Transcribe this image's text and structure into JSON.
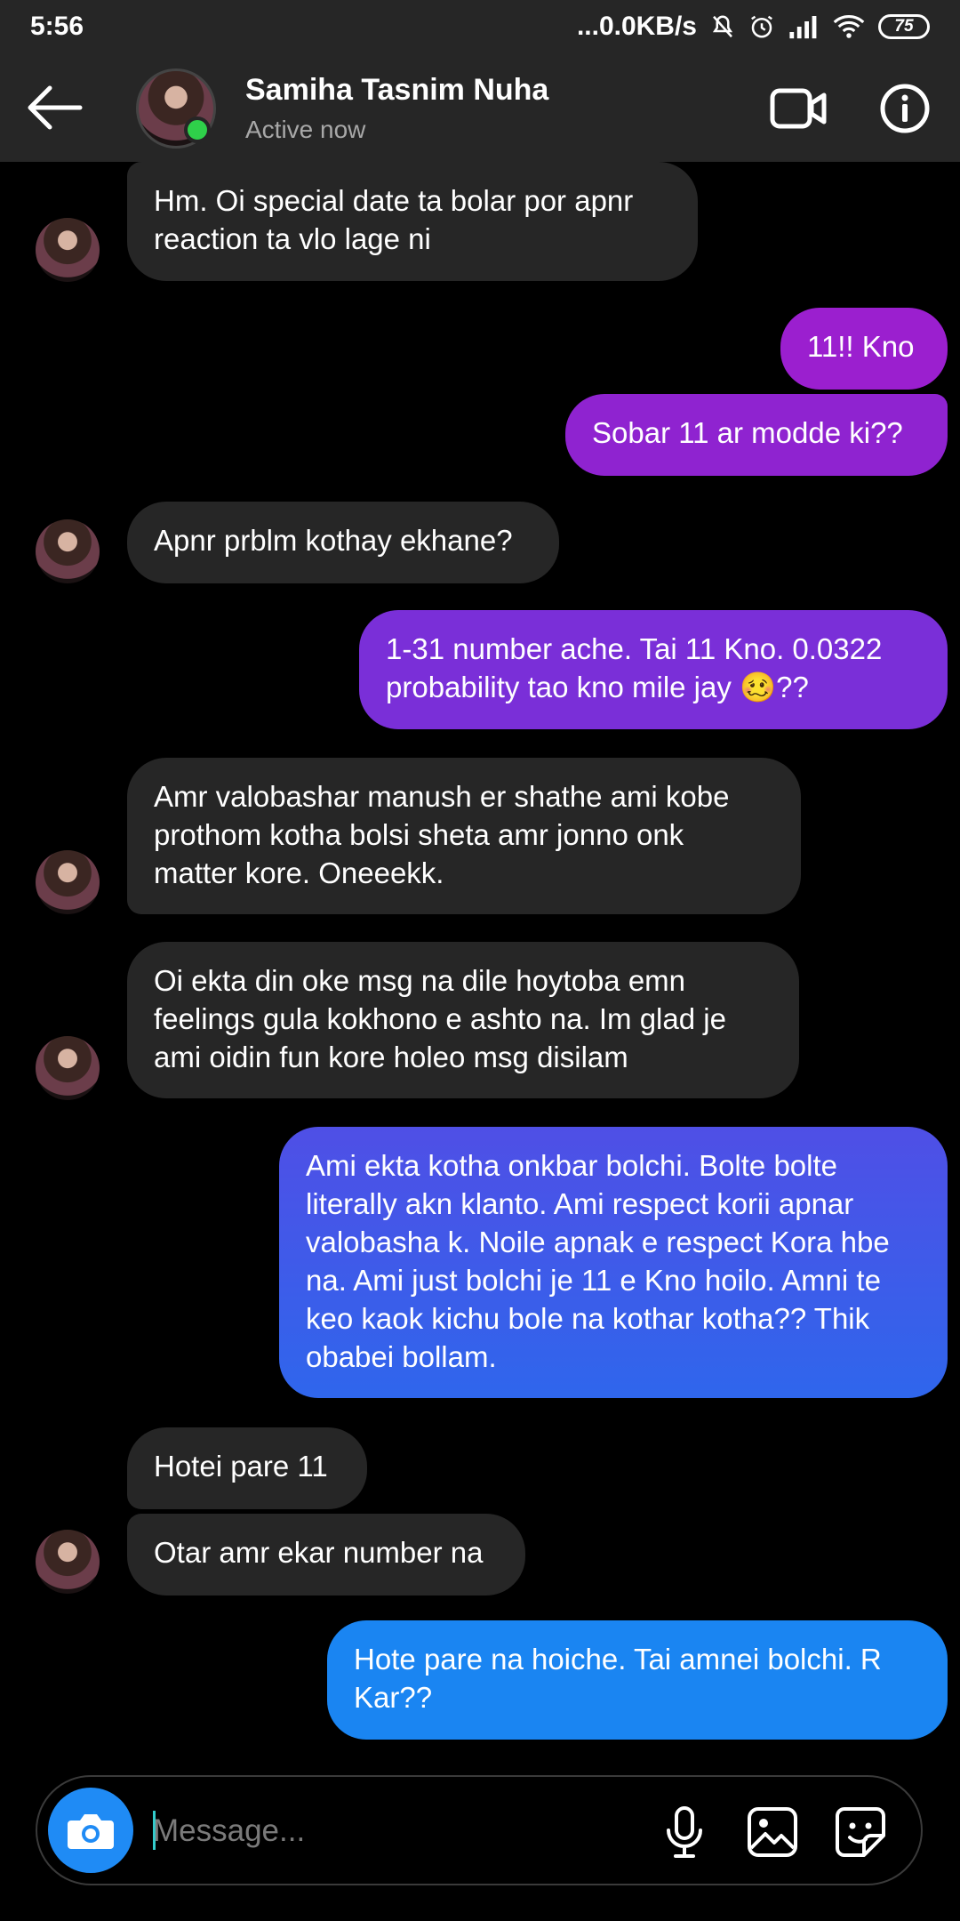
{
  "status_bar": {
    "time": "5:56",
    "network_speed": "...0.0KB/s",
    "battery": "75"
  },
  "header": {
    "contact_name": "Samiha Tasnim Nuha",
    "contact_status": "Active now"
  },
  "messages": [
    {
      "from": "them",
      "text": "Hm. Oi special date ta bolar por apnr\nreaction ta vlo lage ni"
    },
    {
      "from": "me",
      "text": "11!! Kno"
    },
    {
      "from": "me",
      "text": "Sobar 11 ar modde ki??"
    },
    {
      "from": "them",
      "text": "Apnr prblm kothay ekhane?"
    },
    {
      "from": "me",
      "text": "1-31 number ache. Tai 11 Kno. 0.0322\nprobability tao kno mile jay 🥴??"
    },
    {
      "from": "them",
      "text": "Amr valobashar manush er shathe ami kobe\nprothom kotha bolsi sheta amr jonno onk\nmatter kore. Oneeekk."
    },
    {
      "from": "them",
      "text": "Oi ekta din oke msg na dile hoytoba emn\nfeelings gula kokhono e ashto na. Im glad je\nami oidin fun kore holeo msg disilam"
    },
    {
      "from": "me",
      "text": "Ami ekta kotha onkbar bolchi. Bolte bolte\nliterally akn klanto. Ami respect korii apnar\nvalobasha k. Noile apnak e respect Kora hbe\nna. Ami just bolchi je 11 e Kno hoilo. Amni te\nkeo kaok kichu bole na kothar kotha?? Thik\nobabei bollam."
    },
    {
      "from": "them",
      "text": "Hotei pare 11"
    },
    {
      "from": "them",
      "text": "Otar amr ekar number na"
    },
    {
      "from": "me",
      "text": "Hote pare na hoiche. Tai amnei bolchi. R\nKar??"
    }
  ],
  "composer": {
    "placeholder": "Message..."
  },
  "colors": {
    "background": "#000000",
    "bar": "#262626",
    "incoming_bubble": "#262626",
    "online": "#2fd04a",
    "outgoing_gradient": [
      "#9b1fcf",
      "#7a2fd8",
      "#4a54e6",
      "#1d6ff0",
      "#1a85f2"
    ],
    "camera_button": "#1f8bf5"
  },
  "icons": [
    "back-arrow-icon",
    "video-call-icon",
    "info-icon",
    "camera-icon",
    "microphone-icon",
    "gallery-icon",
    "sticker-icon",
    "mute-icon",
    "alarm-icon",
    "signal-icon",
    "wifi-icon",
    "battery-icon"
  ]
}
